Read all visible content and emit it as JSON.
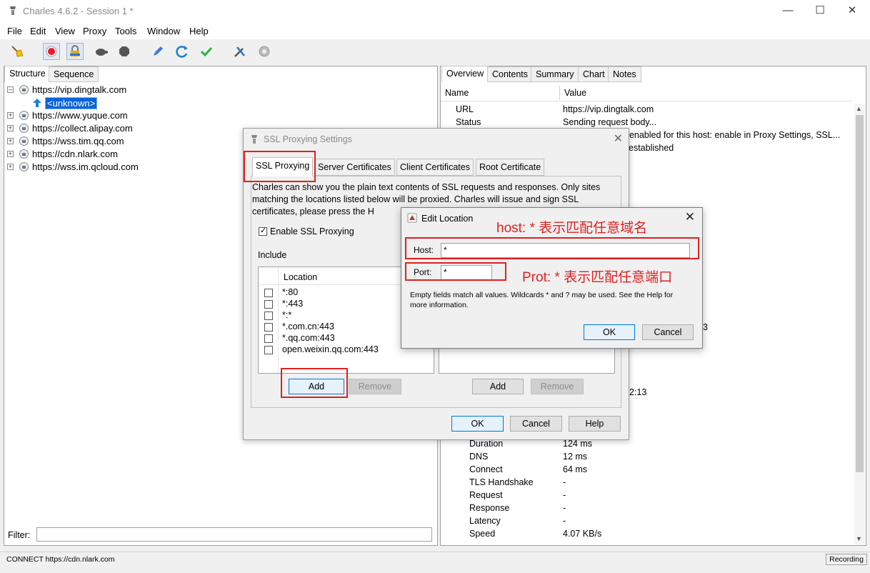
{
  "window": {
    "title": "Charles 4.6.2 - Session 1 *"
  },
  "menu": [
    "File",
    "Edit",
    "View",
    "Proxy",
    "Tools",
    "Window",
    "Help"
  ],
  "left_tabs": [
    "Structure",
    "Sequence"
  ],
  "tree": [
    {
      "label": "https://vip.dingtalk.com",
      "expanded": true
    },
    {
      "label": "<unknown>",
      "child": true
    },
    {
      "label": "https://www.yuque.com"
    },
    {
      "label": "https://collect.alipay.com"
    },
    {
      "label": "https://wss.tim.qq.com"
    },
    {
      "label": "https://cdn.nlark.com"
    },
    {
      "label": "https://wss.im.qcloud.com"
    }
  ],
  "filter": {
    "label": "Filter:"
  },
  "right_tabs": [
    "Overview",
    "Contents",
    "Summary",
    "Chart",
    "Notes"
  ],
  "overview": {
    "col_name": "Name",
    "col_value": "Value",
    "rows": [
      {
        "name": "URL",
        "value": "https://vip.dingtalk.com"
      },
      {
        "name": "Status",
        "value": "Sending request body..."
      }
    ],
    "partial": [
      "t enabled for this host: enable in Proxy Settings, SSL...",
      "established",
      "3",
      "2:13"
    ],
    "timing": [
      {
        "name": "Duration",
        "value": "124 ms"
      },
      {
        "name": "DNS",
        "value": "12 ms"
      },
      {
        "name": "Connect",
        "value": "64 ms"
      },
      {
        "name": "TLS Handshake",
        "value": "-"
      },
      {
        "name": "Request",
        "value": "-"
      },
      {
        "name": "Response",
        "value": "-"
      },
      {
        "name": "Latency",
        "value": "-"
      },
      {
        "name": "Speed",
        "value": "4.07 KB/s"
      }
    ]
  },
  "status": {
    "message": "CONNECT https://cdn.nlark.com",
    "recording": "Recording"
  },
  "ssl_dialog": {
    "title": "SSL Proxying Settings",
    "tabs": [
      "SSL Proxying",
      "Server Certificates",
      "Client Certificates",
      "Root Certificate"
    ],
    "description": "Charles can show you the plain text contents of SSL requests and responses. Only sites matching the locations listed below will be proxied. Charles will issue and sign SSL certificates, please press the H",
    "enable_label": "Enable SSL Proxying",
    "include_label": "Include",
    "location_header": "Location",
    "locations": [
      "*:80",
      "*:443",
      "*:*",
      "*.com.cn:443",
      "*.qq.com:443",
      "open.weixin.qq.com:443"
    ],
    "add": "Add",
    "remove": "Remove",
    "ok": "OK",
    "cancel": "Cancel",
    "help": "Help"
  },
  "edit_dialog": {
    "title": "Edit Location",
    "host_label": "Host:",
    "host_value": "*",
    "port_label": "Port:",
    "port_value": "*",
    "note": "Empty fields match all values. Wildcards * and ? may be used. See the Help for more information.",
    "ok": "OK",
    "cancel": "Cancel"
  },
  "annotations": {
    "host_note": "host: * 表示匹配任意域名",
    "port_note": "Prot: * 表示匹配任意端口"
  },
  "colors": {
    "annotation": "#e02020",
    "selection": "#0a64d6",
    "record": "#e8192c"
  }
}
